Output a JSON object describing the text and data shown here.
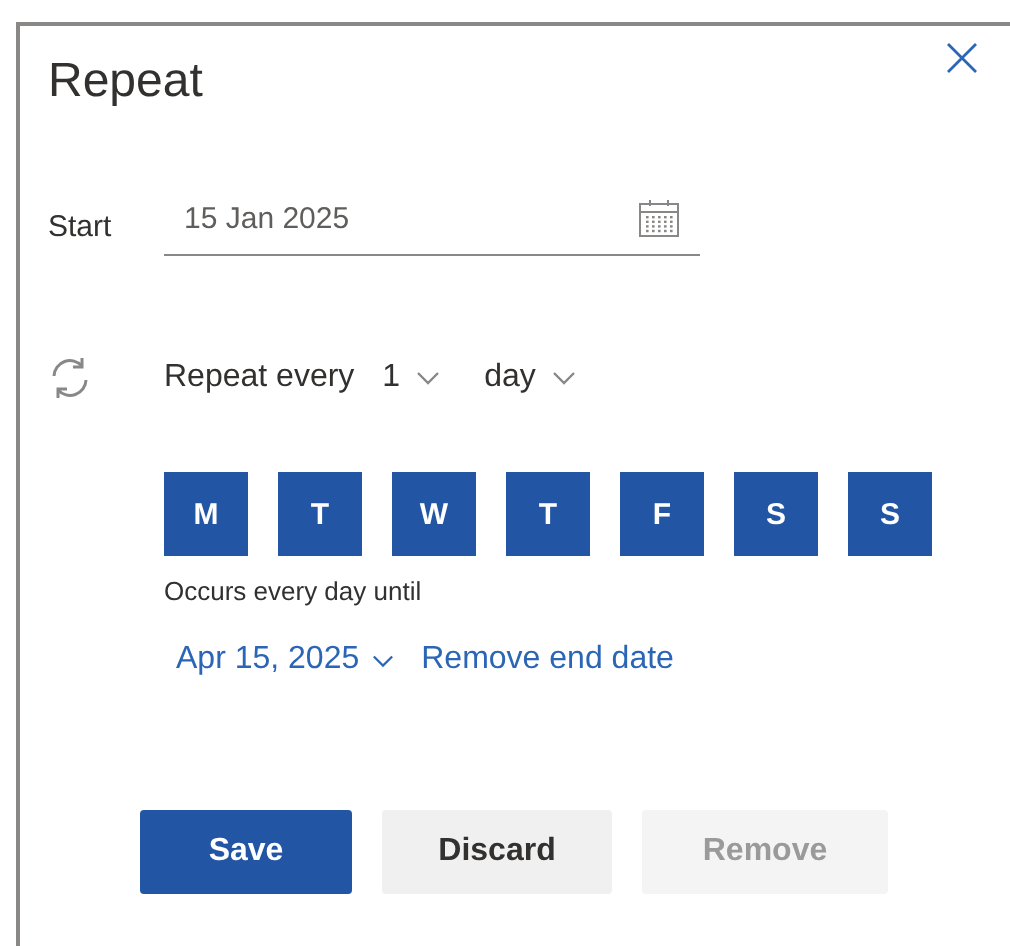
{
  "dialog": {
    "title": "Repeat"
  },
  "start": {
    "label": "Start",
    "value": "15 Jan 2025"
  },
  "repeat": {
    "label": "Repeat every",
    "interval": "1",
    "unit": "day"
  },
  "days": [
    {
      "label": "M",
      "selected": true
    },
    {
      "label": "T",
      "selected": true
    },
    {
      "label": "W",
      "selected": true
    },
    {
      "label": "T",
      "selected": true
    },
    {
      "label": "F",
      "selected": true
    },
    {
      "label": "S",
      "selected": true
    },
    {
      "label": "S",
      "selected": true
    }
  ],
  "summary": "Occurs every day until",
  "end_date": {
    "value": "Apr 15, 2025",
    "remove_link": "Remove end date"
  },
  "buttons": [
    {
      "label": "Save",
      "kind": "primary",
      "disabled": false
    },
    {
      "label": "Discard",
      "kind": "secondary",
      "disabled": false
    },
    {
      "label": "Remove",
      "kind": "secondary",
      "disabled": true
    }
  ]
}
